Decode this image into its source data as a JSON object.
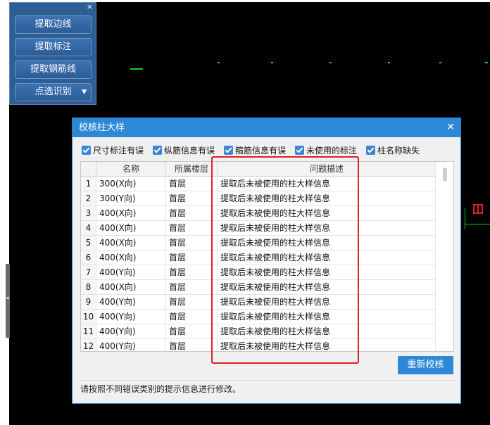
{
  "toolbar": {
    "close_glyph": "×",
    "buttons": [
      {
        "label": "提取边线"
      },
      {
        "label": "提取标注"
      },
      {
        "label": "提取钢筋线"
      },
      {
        "label": "点选识别",
        "dropdown": true
      }
    ]
  },
  "dialog": {
    "title": "校核柱大样",
    "close_glyph": "✕",
    "filters": [
      {
        "label": "尺寸标注有误",
        "checked": true
      },
      {
        "label": "纵筋信息有误",
        "checked": true
      },
      {
        "label": "箍筋信息有误",
        "checked": true
      },
      {
        "label": "未使用的标注",
        "checked": true
      },
      {
        "label": "柱名称缺失",
        "checked": true
      }
    ],
    "table": {
      "columns": [
        "",
        "名称",
        "所属楼层",
        "问题描述"
      ],
      "rows": [
        {
          "no": "1",
          "name": "300(X向)",
          "floor": "首层",
          "desc": "提取后未被使用的柱大样信息"
        },
        {
          "no": "2",
          "name": "300(Y向)",
          "floor": "首层",
          "desc": "提取后未被使用的柱大样信息"
        },
        {
          "no": "3",
          "name": "400(X向)",
          "floor": "首层",
          "desc": "提取后未被使用的柱大样信息"
        },
        {
          "no": "4",
          "name": "400(X向)",
          "floor": "首层",
          "desc": "提取后未被使用的柱大样信息"
        },
        {
          "no": "5",
          "name": "400(X向)",
          "floor": "首层",
          "desc": "提取后未被使用的柱大样信息"
        },
        {
          "no": "6",
          "name": "400(X向)",
          "floor": "首层",
          "desc": "提取后未被使用的柱大样信息"
        },
        {
          "no": "7",
          "name": "400(Y向)",
          "floor": "首层",
          "desc": "提取后未被使用的柱大样信息"
        },
        {
          "no": "8",
          "name": "400(X向)",
          "floor": "首层",
          "desc": "提取后未被使用的柱大样信息"
        },
        {
          "no": "9",
          "name": "400(Y向)",
          "floor": "首层",
          "desc": "提取后未被使用的柱大样信息"
        },
        {
          "no": "10",
          "name": "400(Y向)",
          "floor": "首层",
          "desc": "提取后未被使用的柱大样信息"
        },
        {
          "no": "11",
          "name": "400(Y向)",
          "floor": "首层",
          "desc": "提取后未被使用的柱大样信息"
        },
        {
          "no": "12",
          "name": "400(Y向)",
          "floor": "首层",
          "desc": "提取后未被使用的柱大样信息"
        }
      ]
    },
    "recheck_label": "重新校核",
    "hint": "请按照不同错误类别的提示信息进行修改。"
  },
  "colors": {
    "accent": "#2e88d8",
    "highlight": "#e02020",
    "cad_background": "#000000",
    "cad_line": "#19d019"
  }
}
